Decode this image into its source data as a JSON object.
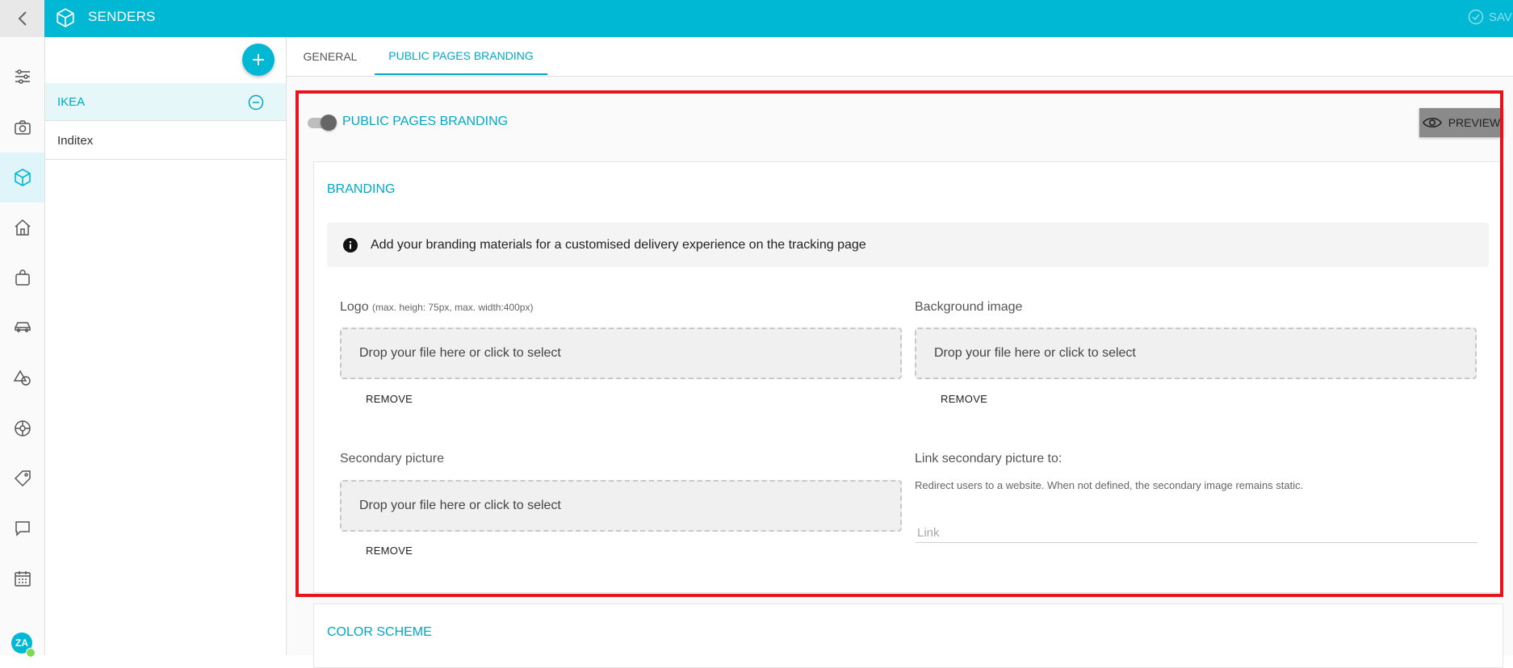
{
  "header": {
    "title": "SENDERS",
    "save_label": "SAVE"
  },
  "rail": {
    "icons": [
      "sliders-icon",
      "camera-icon",
      "cube-icon",
      "home-icon",
      "bag-icon",
      "car-icon",
      "shapes-icon",
      "globe-icon",
      "tag-icon",
      "chat-icon",
      "calendar-icon"
    ],
    "active_icon": "cube-icon",
    "avatar": {
      "initials": "ZA",
      "status_color": "#7ed957"
    }
  },
  "senders": {
    "items": [
      {
        "label": "IKEA",
        "selected": true
      },
      {
        "label": "Inditex",
        "selected": false
      }
    ]
  },
  "tabs": [
    {
      "label": "GENERAL",
      "active": false
    },
    {
      "label": "PUBLIC PAGES BRANDING",
      "active": true
    }
  ],
  "public_pages": {
    "title": "PUBLIC PAGES BRANDING",
    "enabled": true,
    "preview_label": "PREVIEW"
  },
  "branding": {
    "title": "BRANDING",
    "info_text": "Add your branding materials for a customised delivery experience on the tracking page",
    "logo": {
      "label": "Logo",
      "hint": "(max. heigh: 75px, max. width:400px)",
      "drop_text": "Drop your file here or click to select",
      "remove_label": "REMOVE"
    },
    "background": {
      "label": "Background image",
      "drop_text": "Drop your file here or click to select",
      "remove_label": "REMOVE"
    },
    "secondary": {
      "label": "Secondary picture",
      "drop_text": "Drop your file here or click to select",
      "remove_label": "REMOVE"
    },
    "link": {
      "label": "Link secondary picture to:",
      "description": "Redirect users to a website. When not defined, the secondary image remains static.",
      "placeholder": "Link",
      "value": ""
    }
  },
  "color_scheme": {
    "title": "COLOR SCHEME"
  },
  "colors": {
    "accent": "#00b8d4",
    "highlight": "#e8141b"
  }
}
